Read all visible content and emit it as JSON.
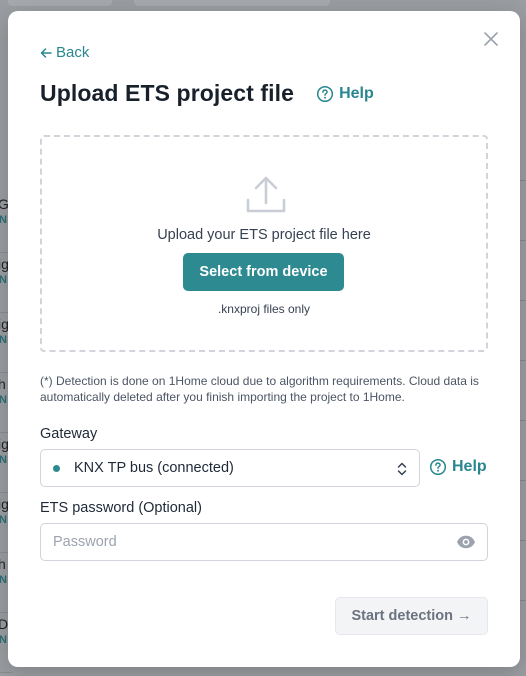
{
  "background": {
    "rows": [
      {
        "title": "Ge",
        "sub": "N"
      },
      {
        "title": "ig",
        "sub": "N"
      },
      {
        "title": "ig",
        "sub": "N"
      },
      {
        "title": "h",
        "sub": "N"
      },
      {
        "title": "ig",
        "sub": "N"
      },
      {
        "title": "ig",
        "sub": "N"
      },
      {
        "title": "h",
        "sub": "N"
      },
      {
        "title": "Dr",
        "sub": "N"
      }
    ]
  },
  "modal": {
    "back_label": "Back",
    "title": "Upload ETS project file",
    "help_label": "Help",
    "dropzone": {
      "text": "Upload your ETS project file here",
      "button_label": "Select from device",
      "note": ".knxproj files only"
    },
    "disclaimer": "(*) Detection is done on 1Home cloud due to algorithm requirements. Cloud data is automatically deleted after you finish importing the project to 1Home.",
    "gateway": {
      "label": "Gateway",
      "value": "KNX TP bus (connected)",
      "status_color": "#2d8a91",
      "help_label": "Help"
    },
    "password": {
      "label": "ETS password (Optional)",
      "placeholder": "Password",
      "value": ""
    },
    "start_button_label": "Start detection →"
  },
  "colors": {
    "accent": "#2d8a91",
    "title": "#18202b",
    "backdrop": "#9a9da1"
  },
  "icons": {
    "close": "close-icon",
    "back": "arrow-left-icon",
    "help": "help-circle-icon",
    "upload": "upload-icon",
    "chevrons": "chevron-up-down-icon",
    "eye": "eye-icon"
  }
}
